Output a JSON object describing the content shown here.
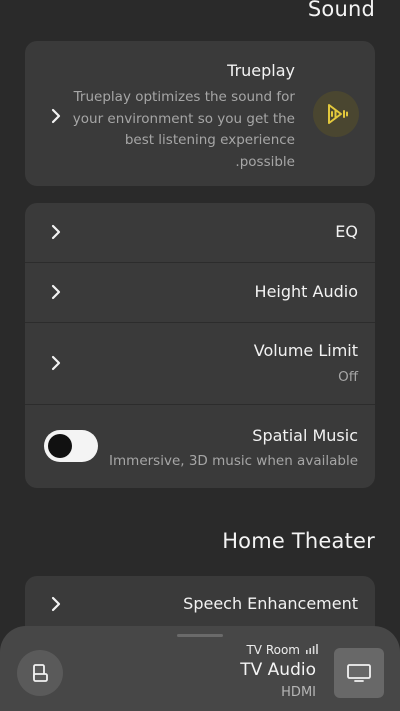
{
  "sections": {
    "sound_title": "Sound",
    "home_theater_title": "Home Theater"
  },
  "trueplay": {
    "title": "Trueplay",
    "description": "Trueplay optimizes the sound for your environment so you get the best listening experience .possible",
    "icon": "trueplay-icon",
    "accent_color": "#e2c83c"
  },
  "sound_items": [
    {
      "label": "EQ"
    },
    {
      "label": "Height Audio"
    },
    {
      "label": "Volume Limit",
      "value": "Off"
    },
    {
      "label": "Spatial Music",
      "description": "Immersive, 3D music when available",
      "enabled": false
    }
  ],
  "home_theater_items": [
    {
      "label": "Speech Enhancement"
    }
  ],
  "now_playing": {
    "room": "TV Room",
    "source": "TV Audio",
    "input": "HDMI"
  },
  "colors": {
    "background": "#2a2a2a",
    "card": "#3a3a3a",
    "bottom_bar": "#474747"
  }
}
